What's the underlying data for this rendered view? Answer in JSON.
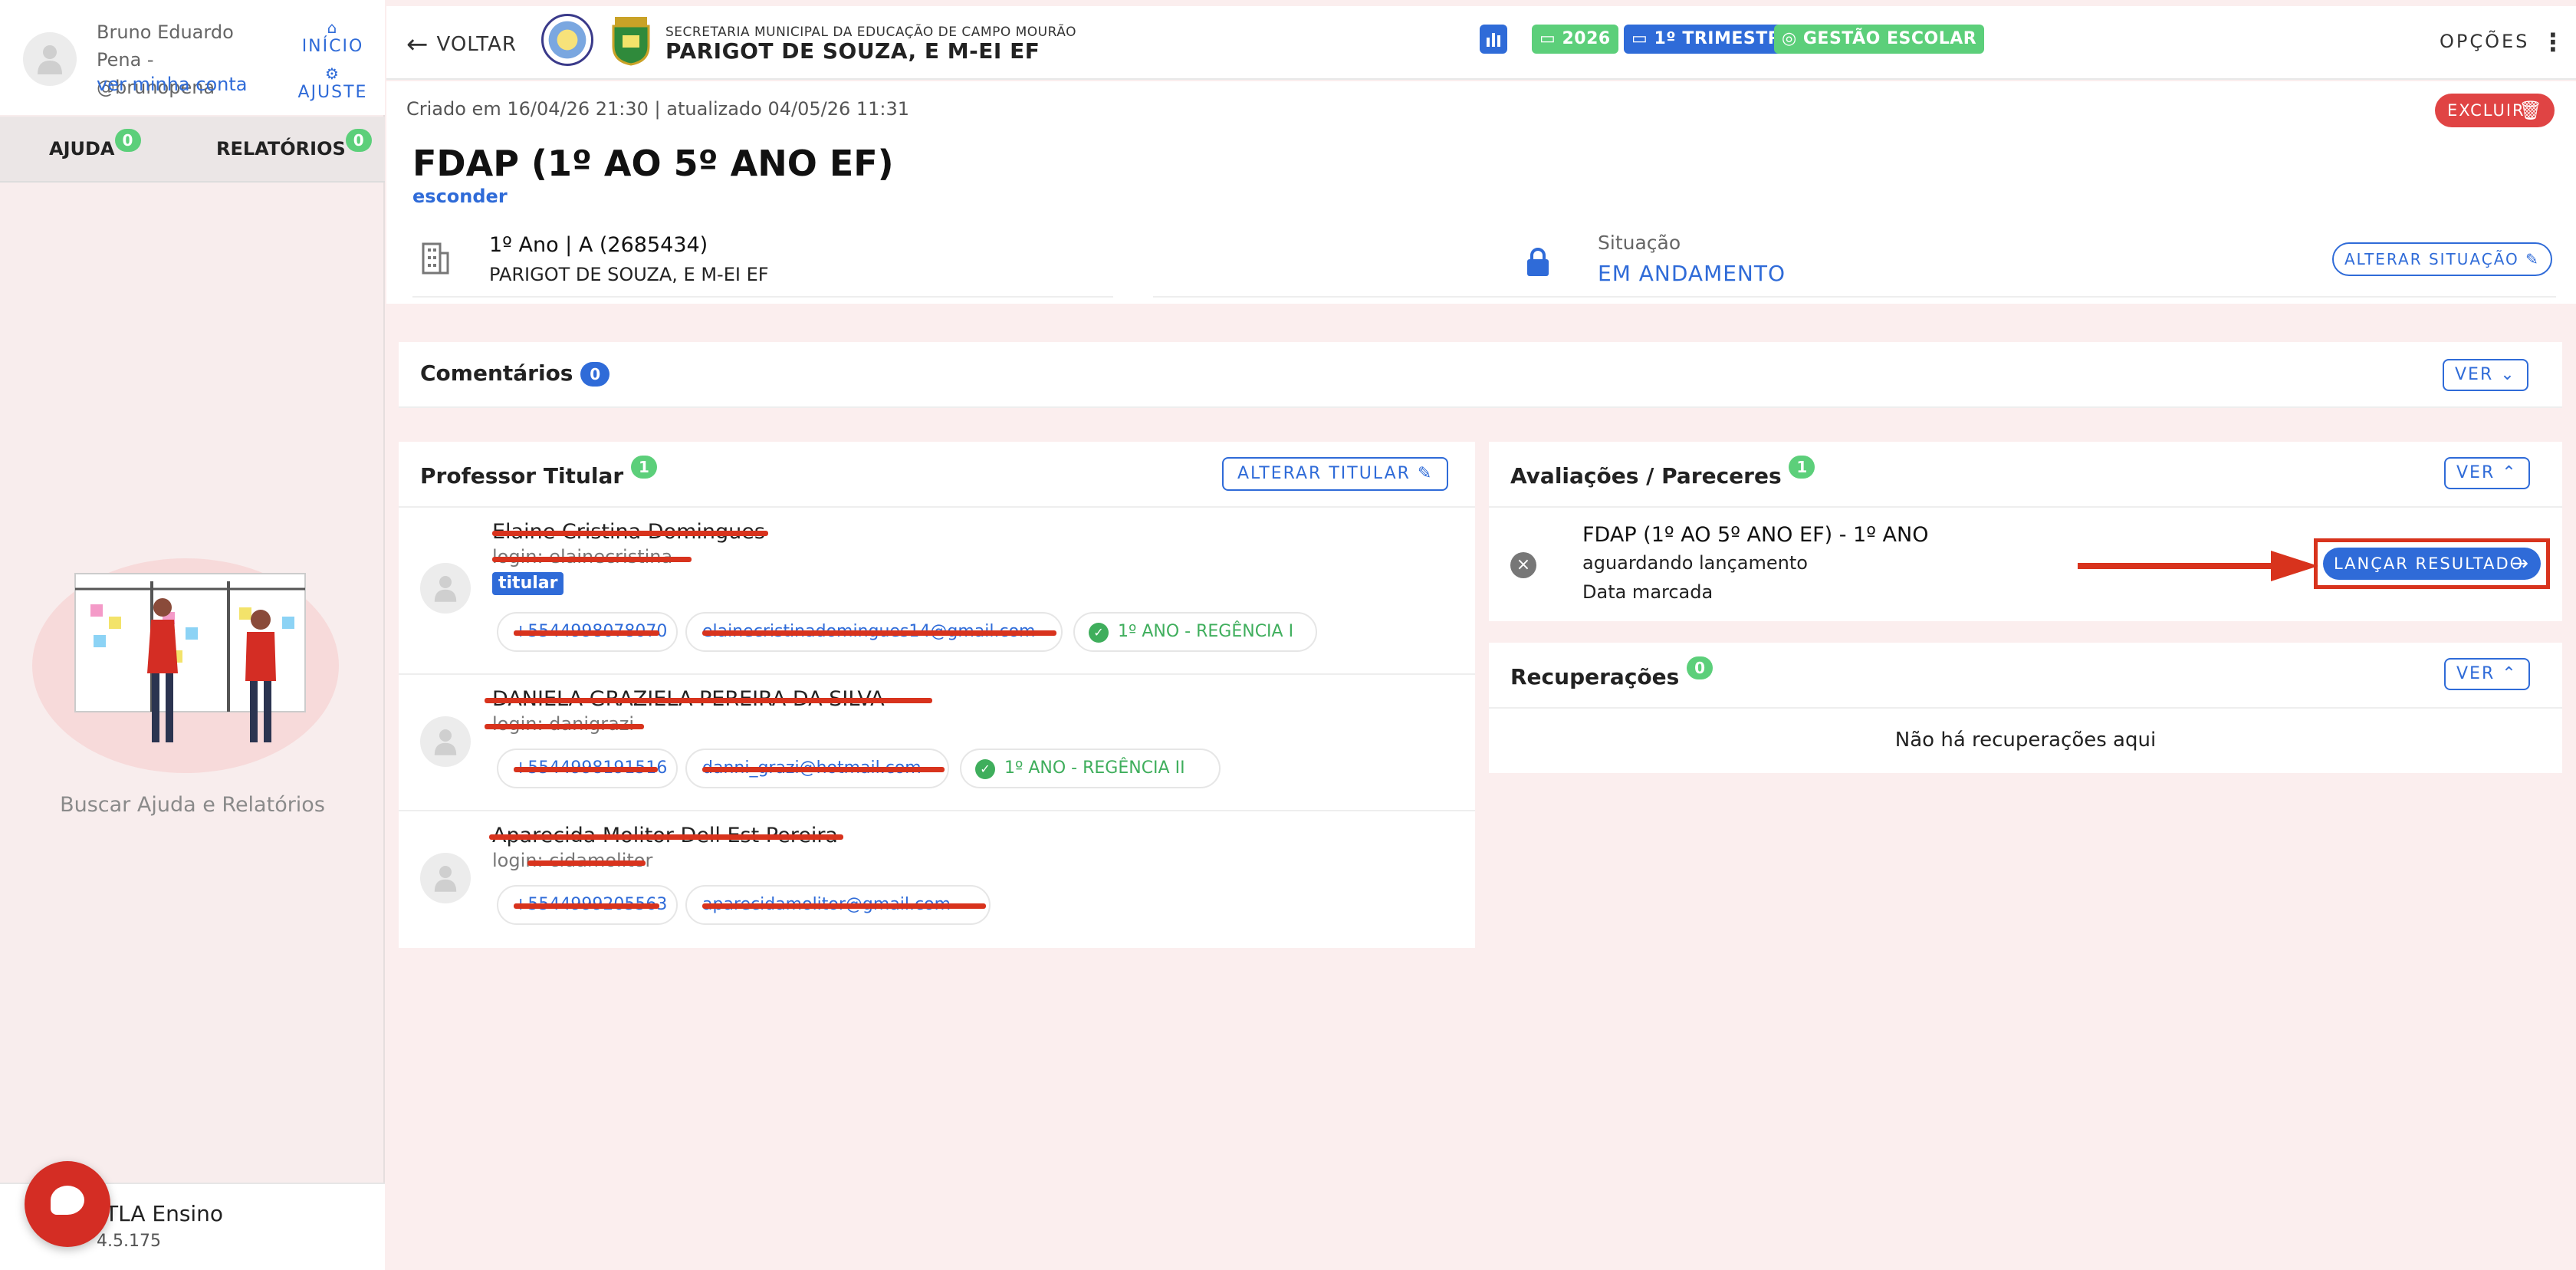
{
  "colors": {
    "accent": "#2f6bd8",
    "danger": "#e04444",
    "success": "#5ccf7a",
    "annotation": "#d8331d"
  },
  "sidebar": {
    "user_name": "Bruno Eduardo Pena - @brunopena",
    "account_link": "ver minha conta",
    "home_label": "INÍCIO",
    "settings_label": "AJUSTE",
    "tabs": [
      {
        "label": "AJUDA",
        "count": "0"
      },
      {
        "label": "RELATÓRIOS",
        "count": "0"
      }
    ],
    "help_text": "Buscar Ajuda e Relatórios",
    "app_name": "ATLA Ensino",
    "app_version": "4.5.175"
  },
  "topbar": {
    "back_label": "VOLTAR",
    "school_subtitle": "SECRETARIA MUNICIPAL DA EDUCAÇÃO DE CAMPO MOURÃO",
    "school_name": "PARIGOT DE SOUZA, E M-EI EF",
    "chips": [
      {
        "icon": "chart-icon",
        "label": "",
        "color": "#2f6bd8"
      },
      {
        "icon": "calendar-icon",
        "label": "2026",
        "color": "#5ccf7a"
      },
      {
        "icon": "calendar-icon",
        "label": "1º TRIMESTRE",
        "color": "#2f6bd8"
      },
      {
        "icon": "check-circle-icon",
        "label": "GESTÃO ESCOLAR",
        "color": "#5ccf7a"
      }
    ],
    "options_label": "OPÇÕES"
  },
  "header": {
    "meta": "Criado em 16/04/26 21:30 | atualizado 04/05/26 11:31",
    "delete_label": "EXCLUIR",
    "title": "FDAP (1º AO 5º ANO EF)",
    "hide_link": "esconder",
    "class_name": "1º Ano | A (2685434)",
    "class_school": "PARIGOT DE SOUZA, E M-EI EF",
    "status_label": "Situação",
    "status_value": "EM ANDAMENTO",
    "change_status_label": "ALTERAR SITUAÇÃO"
  },
  "comments": {
    "title": "Comentários",
    "count": "0",
    "view_label": "VER"
  },
  "teachers": {
    "title": "Professor Titular",
    "count": "1",
    "change_label": "ALTERAR TITULAR",
    "titular_tag": "titular",
    "rows": [
      {
        "name": "Elaine Cristina Domingues",
        "login": "login: elainecristina",
        "phone": "+5544998078070",
        "email": "elainecristinadomingues14@gmail.com",
        "class": "1º ANO - REGÊNCIA I"
      },
      {
        "name": "DANIELA GRAZIELA PEREIRA DA SILVA",
        "login": "login: danigrazi",
        "phone": "+5544998191516",
        "email": "danni_grazi@hotmail.com",
        "class": "1º ANO - REGÊNCIA II"
      },
      {
        "name": "Aparecida Molitor Dell Est Pereira",
        "login": "login: cidamolitor",
        "phone": "+5544999205563",
        "email": "aparecidamolitor@gmail.com",
        "class": ""
      }
    ]
  },
  "evaluations": {
    "title": "Avaliações / Pareceres",
    "count": "1",
    "view_label": "VER",
    "item_title": "FDAP (1º AO 5º ANO EF) - 1º ANO",
    "item_status": "aguardando lançamento",
    "item_date": "Data marcada",
    "launch_label": "LANÇAR RESULTADO"
  },
  "recoveries": {
    "title": "Recuperações",
    "count": "0",
    "view_label": "VER",
    "empty_text": "Não há recuperações aqui"
  }
}
